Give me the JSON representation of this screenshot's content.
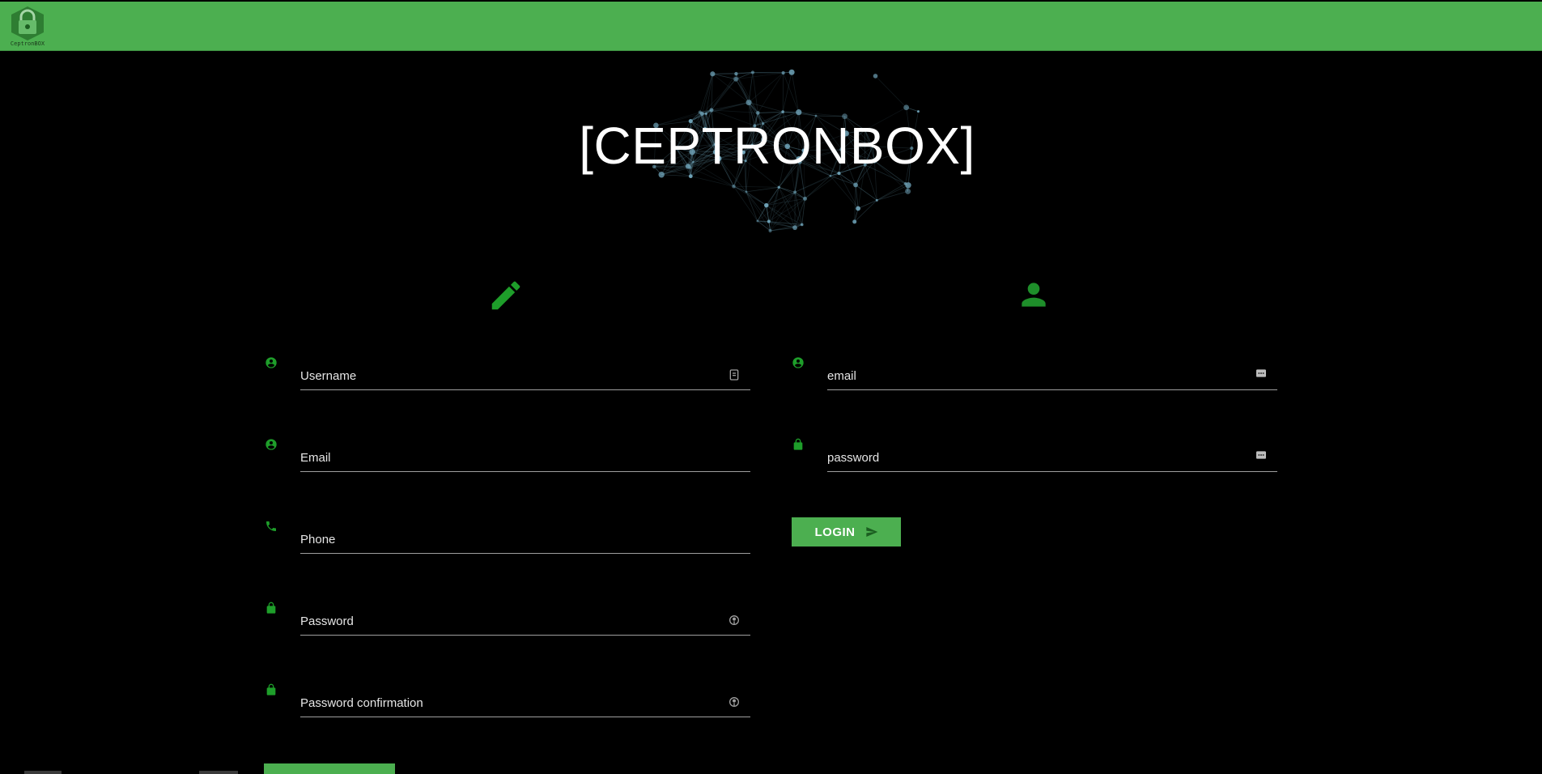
{
  "header": {
    "logo_caption": "CeptronBOX",
    "brand_color": "#4caf50"
  },
  "hero": {
    "title": "[CEPTRONBOX]"
  },
  "register": {
    "section_icon": "pencil-icon",
    "fields": [
      {
        "label": "Username",
        "lead_icon": "account-circle-icon",
        "trail_icon": "contact-card-icon"
      },
      {
        "label": "Email",
        "lead_icon": "account-circle-icon"
      },
      {
        "label": "Phone",
        "lead_icon": "phone-icon"
      },
      {
        "label": "Password",
        "lead_icon": "lock-icon",
        "trail_icon": "visibility-toggle-icon"
      },
      {
        "label": "Password confirmation",
        "lead_icon": "lock-icon",
        "trail_icon": "visibility-toggle-icon"
      }
    ]
  },
  "login": {
    "section_icon": "person-icon",
    "fields": [
      {
        "label": "email",
        "lead_icon": "account-circle-icon",
        "trail_icon": "ellipsis-icon"
      },
      {
        "label": "password",
        "lead_icon": "lock-icon",
        "trail_icon": "ellipsis-icon"
      }
    ],
    "button_label": "LOGIN",
    "button_icon": "send-icon"
  }
}
